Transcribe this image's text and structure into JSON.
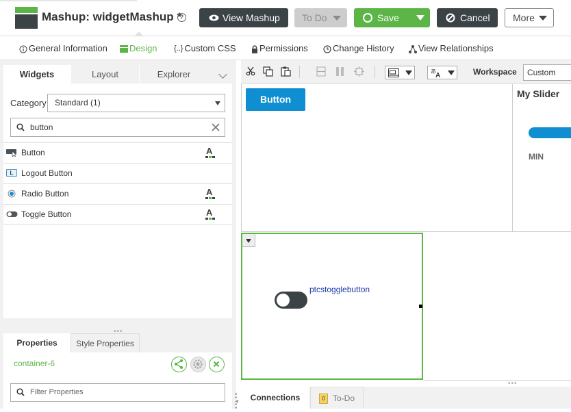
{
  "header": {
    "title": "Mashup: widgetMashup *",
    "help_icon": "?",
    "view_label": "View Mashup",
    "todo_label": "To Do",
    "save_label": "Save",
    "cancel_label": "Cancel",
    "more_label": "More"
  },
  "tabs": [
    {
      "label": "General Information",
      "icon": "info-icon"
    },
    {
      "label": "Design",
      "icon": "design-icon",
      "active": true
    },
    {
      "label": "Custom CSS",
      "icon": "braces-icon"
    },
    {
      "label": "Permissions",
      "icon": "lock-icon"
    },
    {
      "label": "Change History",
      "icon": "clock-icon"
    },
    {
      "label": "View Relationships",
      "icon": "relationships-icon"
    }
  ],
  "left_tabs": {
    "widgets": "Widgets",
    "layout": "Layout",
    "explorer": "Explorer"
  },
  "category": {
    "label": "Category",
    "value": "Standard (1)"
  },
  "search": {
    "value": "button"
  },
  "widgets": [
    {
      "label": "Button",
      "icon": "button-icon",
      "badge": "A"
    },
    {
      "label": "Logout Button",
      "icon": "logout-button-icon",
      "badge": ""
    },
    {
      "label": "Radio Button",
      "icon": "radio-icon",
      "badge": "A"
    },
    {
      "label": "Toggle Button",
      "icon": "toggle-icon",
      "badge": "A"
    }
  ],
  "props": {
    "tab_properties": "Properties",
    "tab_style": "Style Properties",
    "container_name": "container-6",
    "filter_placeholder": "Filter Properties"
  },
  "toolbar": {
    "workspace_label": "Workspace",
    "workspace_value": "Custom"
  },
  "canvas": {
    "button_label": "Button",
    "slider_title": "My Slider",
    "slider_min": "MIN",
    "toggle_label": "ptcstogglebutton"
  },
  "bottom_tabs": {
    "connections": "Connections",
    "todo": "To-Do",
    "todo_count": "0"
  },
  "colors": {
    "brand_green": "#5bb547",
    "dark": "#3b4347",
    "blue": "#0f8fd1"
  }
}
